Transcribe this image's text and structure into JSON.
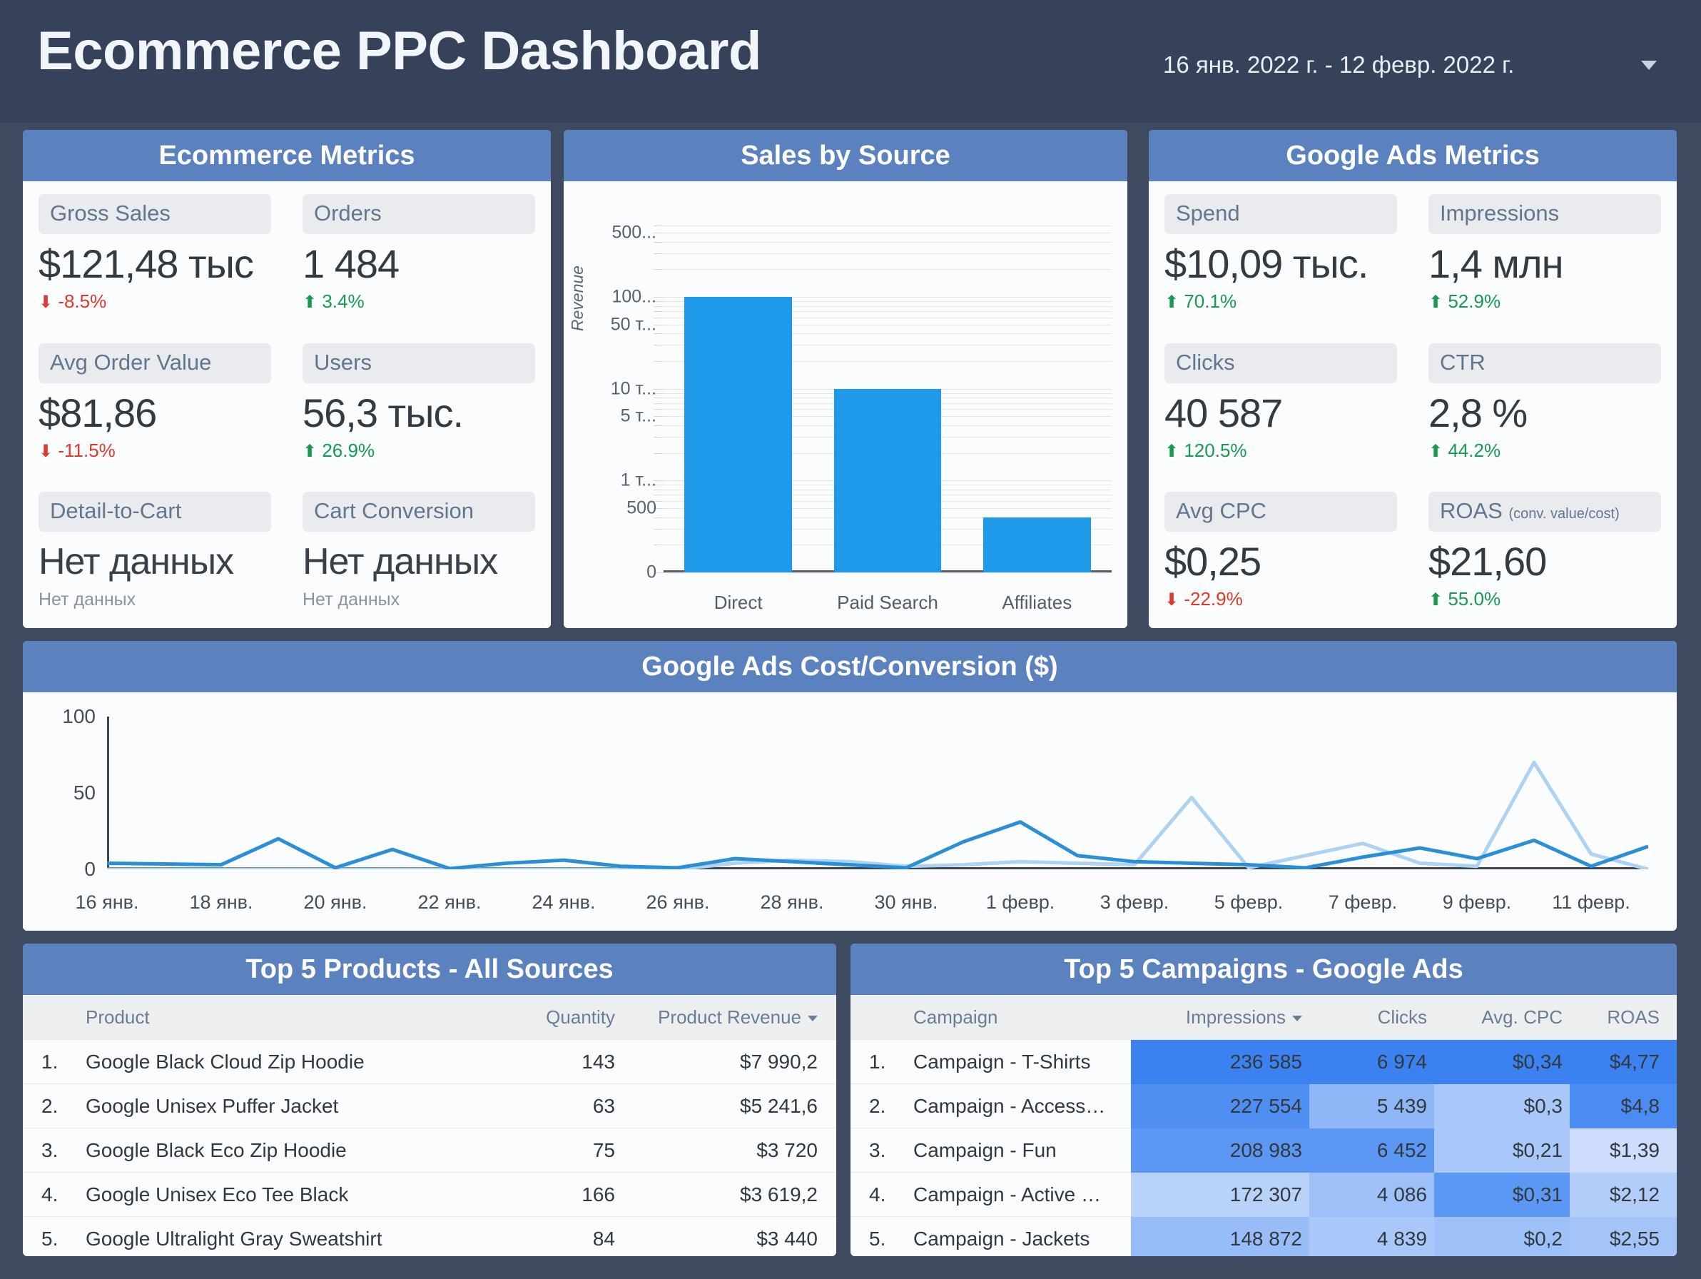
{
  "header": {
    "title": "Ecommerce PPC Dashboard",
    "date_range": "16 янв. 2022 г. - 12 февр. 2022 г."
  },
  "ecommerce_metrics": {
    "title": "Ecommerce Metrics",
    "cards": [
      {
        "label": "Gross Sales",
        "value": "$121,48 тыс",
        "delta": "-8.5%",
        "dir": "down"
      },
      {
        "label": "Orders",
        "value": "1 484",
        "delta": "3.4%",
        "dir": "up"
      },
      {
        "label": "Avg Order Value",
        "value": "$81,86",
        "delta": "-11.5%",
        "dir": "down"
      },
      {
        "label": "Users",
        "value": "56,3 тыс.",
        "delta": "26.9%",
        "dir": "up"
      },
      {
        "label": "Detail-to-Cart",
        "value": "Нет данных",
        "sub": "Нет данных"
      },
      {
        "label": "Cart Conversion",
        "value": "Нет данных",
        "sub": "Нет данных"
      }
    ]
  },
  "google_ads_metrics": {
    "title": "Google Ads Metrics",
    "cards": [
      {
        "label": "Spend",
        "value": "$10,09 тыс.",
        "delta": "70.1%",
        "dir": "up"
      },
      {
        "label": "Impressions",
        "value": "1,4 млн",
        "delta": "52.9%",
        "dir": "up"
      },
      {
        "label": "Clicks",
        "value": "40 587",
        "delta": "120.5%",
        "dir": "up"
      },
      {
        "label": "CTR",
        "value": "2,8 %",
        "delta": "44.2%",
        "dir": "up"
      },
      {
        "label": "Avg CPC",
        "value": "$0,25",
        "delta": "-22.9%",
        "dir": "down"
      },
      {
        "label": "ROAS",
        "label_sub": "(conv. value/cost)",
        "value": "$21,60",
        "delta": "55.0%",
        "dir": "up"
      }
    ]
  },
  "top_products": {
    "title": "Top 5 Products - All Sources",
    "columns": [
      "Product",
      "Quantity",
      "Product Revenue"
    ],
    "sorted_by": "Product Revenue",
    "rows": [
      {
        "rank": "1.",
        "product": "Google Black Cloud Zip Hoodie",
        "quantity": "143",
        "revenue": "$7 990,2"
      },
      {
        "rank": "2.",
        "product": "Google Unisex Puffer Jacket",
        "quantity": "63",
        "revenue": "$5 241,6"
      },
      {
        "rank": "3.",
        "product": "Google Black Eco Zip Hoodie",
        "quantity": "75",
        "revenue": "$3 720"
      },
      {
        "rank": "4.",
        "product": "Google Unisex Eco Tee Black",
        "quantity": "166",
        "revenue": "$3 619,2"
      },
      {
        "rank": "5.",
        "product": "Google Ultralight Gray Sweatshirt",
        "quantity": "84",
        "revenue": "$3 440"
      }
    ]
  },
  "top_campaigns": {
    "title": "Top 5 Campaigns - Google Ads",
    "columns": [
      "Campaign",
      "Impressions",
      "Clicks",
      "Avg. CPC",
      "ROAS"
    ],
    "sorted_by": "Impressions",
    "rows": [
      {
        "rank": "1.",
        "campaign": "Campaign - T-Shirts",
        "impressions": "236 585",
        "clicks": "6 974",
        "cpc": "$0,34",
        "roas": "$4,77",
        "heat": {
          "impressions": "#3b82f0",
          "clicks": "#3b82f0",
          "cpc": "#3b82f0",
          "roas": "#3b82f0"
        }
      },
      {
        "rank": "2.",
        "campaign": "Campaign - Access…",
        "impressions": "227 554",
        "clicks": "5 439",
        "cpc": "$0,3",
        "roas": "$4,8",
        "heat": {
          "impressions": "#4f8ff2",
          "clicks": "#8fb7f7",
          "cpc": "#a9c8f9",
          "roas": "#4a8cf2"
        }
      },
      {
        "rank": "3.",
        "campaign": "Campaign - Fun",
        "impressions": "208 983",
        "clicks": "6 452",
        "cpc": "$0,21",
        "roas": "$1,39",
        "heat": {
          "impressions": "#5b97f3",
          "clicks": "#5b97f3",
          "cpc": "#a9c8f9",
          "roas": "#cdddfb"
        }
      },
      {
        "rank": "4.",
        "campaign": "Campaign - Active …",
        "impressions": "172 307",
        "clicks": "4 086",
        "cpc": "$0,31",
        "roas": "$2,12",
        "heat": {
          "impressions": "#b9d2fa",
          "clicks": "#9dc0f8",
          "cpc": "#5b97f3",
          "roas": "#b3cdfa"
        }
      },
      {
        "rank": "5.",
        "campaign": "Campaign - Jackets",
        "impressions": "148 872",
        "clicks": "4 839",
        "cpc": "$0,2",
        "roas": "$2,55",
        "heat": {
          "impressions": "#97bcf7",
          "clicks": "#a9c8f9",
          "cpc": "#9dc0f8",
          "roas": "#a4c4f8"
        }
      }
    ]
  },
  "chart_data": [
    {
      "type": "bar",
      "title": "Sales by Source",
      "categories": [
        "Direct",
        "Paid Search",
        "Affiliates"
      ],
      "values": [
        100000,
        10000,
        400
      ],
      "value_labels": [
        "100 тыс.",
        "10 тыс.",
        "400"
      ],
      "ylabel": "Revenue",
      "xlabel": "",
      "yscale": "log",
      "yticks": [
        "500...",
        "100...",
        "50 т...",
        "10 т...",
        "5 т...",
        "1 т...",
        "500",
        "0"
      ],
      "grid": true,
      "legend": "none",
      "series_color": "#1f9aeb"
    },
    {
      "type": "line",
      "title": "Google Ads  Cost/Conversion ($)",
      "xlabel": "",
      "ylabel": "",
      "ylim": [
        0,
        100
      ],
      "yticks": [
        0,
        50,
        100
      ],
      "grid": false,
      "legend": "none",
      "xtick_labels": [
        "16 янв.",
        "18 янв.",
        "20 янв.",
        "22 янв.",
        "24 янв.",
        "26 янв.",
        "28 янв.",
        "30 янв.",
        "1 февр.",
        "3 февр.",
        "5 февр.",
        "7 февр.",
        "9 февр.",
        "11 февр."
      ],
      "x": [
        "16 янв.",
        "17 янв.",
        "18 янв.",
        "19 янв.",
        "20 янв.",
        "21 янв.",
        "22 янв.",
        "23 янв.",
        "24 янв.",
        "25 янв.",
        "26 янв.",
        "27 янв.",
        "28 янв.",
        "29 янв.",
        "30 янв.",
        "31 янв.",
        "1 февр.",
        "2 февр.",
        "3 февр.",
        "4 февр.",
        "5 февр.",
        "6 февр.",
        "7 февр.",
        "8 февр.",
        "9 февр.",
        "10 февр.",
        "11 февр.",
        "12 февр."
      ],
      "series": [
        {
          "name": "Cost/Conv (current)",
          "color": "#2b8fd6",
          "values": [
            4,
            3.5,
            3,
            20,
            1,
            13,
            0.5,
            4,
            6,
            2,
            1,
            7,
            5,
            3,
            1,
            18,
            31,
            9,
            5,
            4,
            3,
            1,
            8,
            14,
            7,
            19,
            2,
            15
          ]
        },
        {
          "name": "Cost/Conv (previous)",
          "color": "#aed3f2",
          "values": [
            0,
            0,
            0,
            0,
            0,
            0,
            0,
            0,
            0,
            0,
            0,
            4,
            6,
            5,
            2,
            3,
            5,
            4,
            3,
            47,
            1,
            9,
            17,
            4,
            2,
            70,
            10,
            0,
            24
          ]
        }
      ]
    }
  ]
}
